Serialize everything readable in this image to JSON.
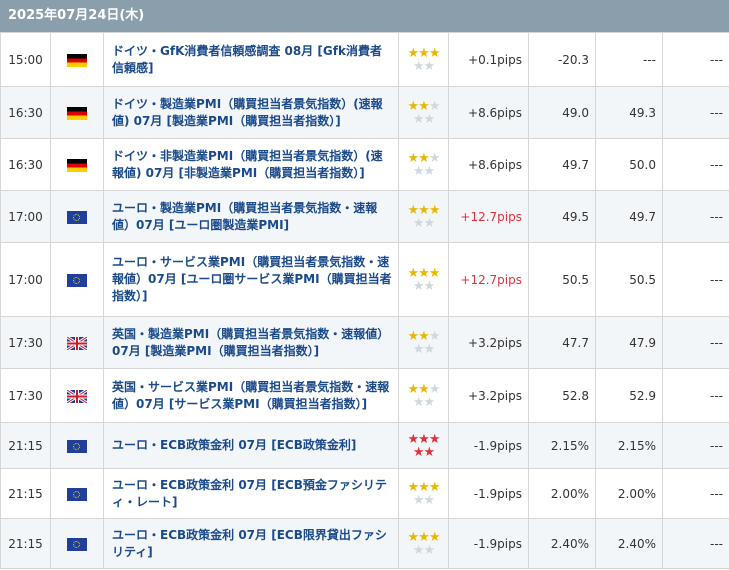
{
  "date_header": "2025年07月24日(木)",
  "colors": {
    "header_bg": "#8a9eab",
    "event_text": "#1a4a8a",
    "star_gold": "#e8b800",
    "star_red": "#e0323a",
    "pips_red": "#e0323a"
  },
  "rows": [
    {
      "time": "15:00",
      "flag": "germany-flag-icon",
      "event": "ドイツ・GfK消費者信頼感調査 08月 [Gfk消費者信頼感]",
      "importance": 3,
      "pips": "+0.1pips",
      "pips_red": false,
      "actual": "-20.3",
      "forecast": "---",
      "previous": "---"
    },
    {
      "time": "16:30",
      "flag": "germany-flag-icon",
      "event": "ドイツ・製造業PMI（購買担当者景気指数）(速報値) 07月 [製造業PMI（購買担当者指数）]",
      "importance": 2,
      "pips": "+8.6pips",
      "pips_red": false,
      "actual": "49.0",
      "forecast": "49.3",
      "previous": "---"
    },
    {
      "time": "16:30",
      "flag": "germany-flag-icon",
      "event": "ドイツ・非製造業PMI（購買担当者景気指数）(速報値) 07月 [非製造業PMI（購買担当者指数）]",
      "importance": 2,
      "pips": "+8.6pips",
      "pips_red": false,
      "actual": "49.7",
      "forecast": "50.0",
      "previous": "---"
    },
    {
      "time": "17:00",
      "flag": "eu-flag-icon",
      "event": "ユーロ・製造業PMI（購買担当者景気指数・速報値）07月 [ユーロ圏製造業PMI]",
      "importance": 3,
      "pips": "+12.7pips",
      "pips_red": true,
      "actual": "49.5",
      "forecast": "49.7",
      "previous": "---"
    },
    {
      "time": "17:00",
      "flag": "eu-flag-icon",
      "event": "ユーロ・サービス業PMI（購買担当者景気指数・速報値）07月 [ユーロ圏サービス業PMI（購買担当者指数）]",
      "importance": 3,
      "pips": "+12.7pips",
      "pips_red": true,
      "actual": "50.5",
      "forecast": "50.5",
      "previous": "---"
    },
    {
      "time": "17:30",
      "flag": "uk-flag-icon",
      "event": "英国・製造業PMI（購買担当者景気指数・速報値）07月 [製造業PMI（購買担当者指数）]",
      "importance": 2,
      "pips": "+3.2pips",
      "pips_red": false,
      "actual": "47.7",
      "forecast": "47.9",
      "previous": "---"
    },
    {
      "time": "17:30",
      "flag": "uk-flag-icon",
      "event": "英国・サービス業PMI（購買担当者景気指数・速報値）07月 [サービス業PMI（購買担当者指数）]",
      "importance": 2,
      "pips": "+3.2pips",
      "pips_red": false,
      "actual": "52.8",
      "forecast": "52.9",
      "previous": "---"
    },
    {
      "time": "21:15",
      "flag": "eu-flag-icon",
      "event": "ユーロ・ECB政策金利 07月 [ECB政策金利]",
      "importance": 5,
      "pips": "-1.9pips",
      "pips_red": false,
      "actual": "2.15%",
      "forecast": "2.15%",
      "previous": "---"
    },
    {
      "time": "21:15",
      "flag": "eu-flag-icon",
      "event": "ユーロ・ECB政策金利 07月 [ECB預金ファシリティ・レート]",
      "importance": 3,
      "pips": "-1.9pips",
      "pips_red": false,
      "actual": "2.00%",
      "forecast": "2.00%",
      "previous": "---"
    },
    {
      "time": "21:15",
      "flag": "eu-flag-icon",
      "event": "ユーロ・ECB政策金利 07月 [ECB限界貸出ファシリティ]",
      "importance": 3,
      "pips": "-1.9pips",
      "pips_red": false,
      "actual": "2.40%",
      "forecast": "2.40%",
      "previous": "---"
    }
  ]
}
